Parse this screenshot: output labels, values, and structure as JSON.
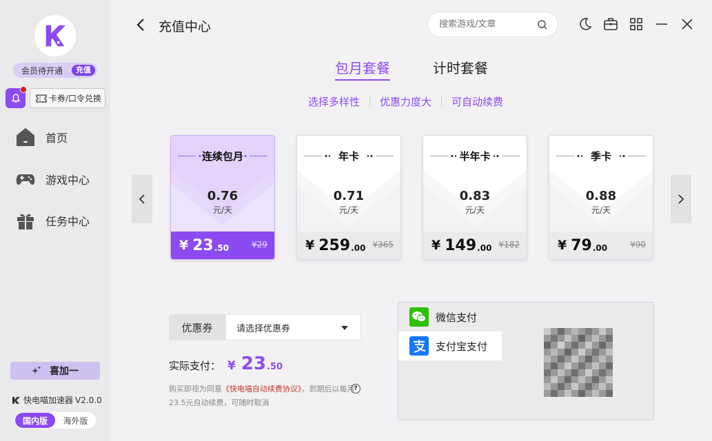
{
  "sidebar": {
    "logo_letter": "K",
    "vip_status": "会员待开通",
    "recharge_label": "充值",
    "coupon_exchange_label": "卡券/口令兑换",
    "nav": [
      {
        "label": "首页",
        "icon": "home-icon"
      },
      {
        "label": "游戏中心",
        "icon": "gamepad-icon"
      },
      {
        "label": "任务中心",
        "icon": "gift-icon"
      }
    ],
    "plus_one_label": "喜加一",
    "app_name": "快电喵加速器",
    "version": "V2.0.0",
    "region_domestic": "国内版",
    "region_overseas": "海外版"
  },
  "header": {
    "title": "充值中心",
    "search_placeholder": "搜索游戏/文章"
  },
  "tabs": [
    {
      "label": "包月套餐",
      "active": true
    },
    {
      "label": "计时套餐",
      "active": false
    }
  ],
  "features": [
    "选择多样性",
    "优惠力度大",
    "可自动续费"
  ],
  "plans": [
    {
      "name": "连续包月",
      "per_day": "0.76",
      "unit": "元/天",
      "currency": "¥",
      "price_int": "23",
      "price_dec": ".50",
      "original": "¥29",
      "selected": true
    },
    {
      "name": "年卡",
      "per_day": "0.71",
      "unit": "元/天",
      "currency": "¥",
      "price_int": "259",
      "price_dec": ".00",
      "original": "¥365",
      "selected": false
    },
    {
      "name": "半年卡",
      "per_day": "0.83",
      "unit": "元/天",
      "currency": "¥",
      "price_int": "149",
      "price_dec": ".00",
      "original": "¥182",
      "selected": false
    },
    {
      "name": "季卡",
      "per_day": "0.88",
      "unit": "元/天",
      "currency": "¥",
      "price_int": "79",
      "price_dec": ".00",
      "original": "¥90",
      "selected": false
    }
  ],
  "coupon": {
    "label": "优惠券",
    "placeholder": "请选择优惠券"
  },
  "actual_payment": {
    "label": "实际支付：",
    "currency": "¥",
    "int": "23",
    "dec": ".50"
  },
  "agreement": {
    "prefix": "购买即视为同意",
    "link": "《快电喵自动续费协议》",
    "suffix": "，到期后以每月23.5元自动续费，可随时取消",
    "help": "?"
  },
  "payment_methods": [
    {
      "label": "微信支付",
      "icon": "wechat-icon",
      "active": true
    },
    {
      "label": "支付宝支付",
      "icon": "alipay-icon",
      "active": false
    }
  ],
  "colors": {
    "accent": "#8c4bf0",
    "wechat": "#2dc100",
    "alipay": "#1677ff"
  }
}
